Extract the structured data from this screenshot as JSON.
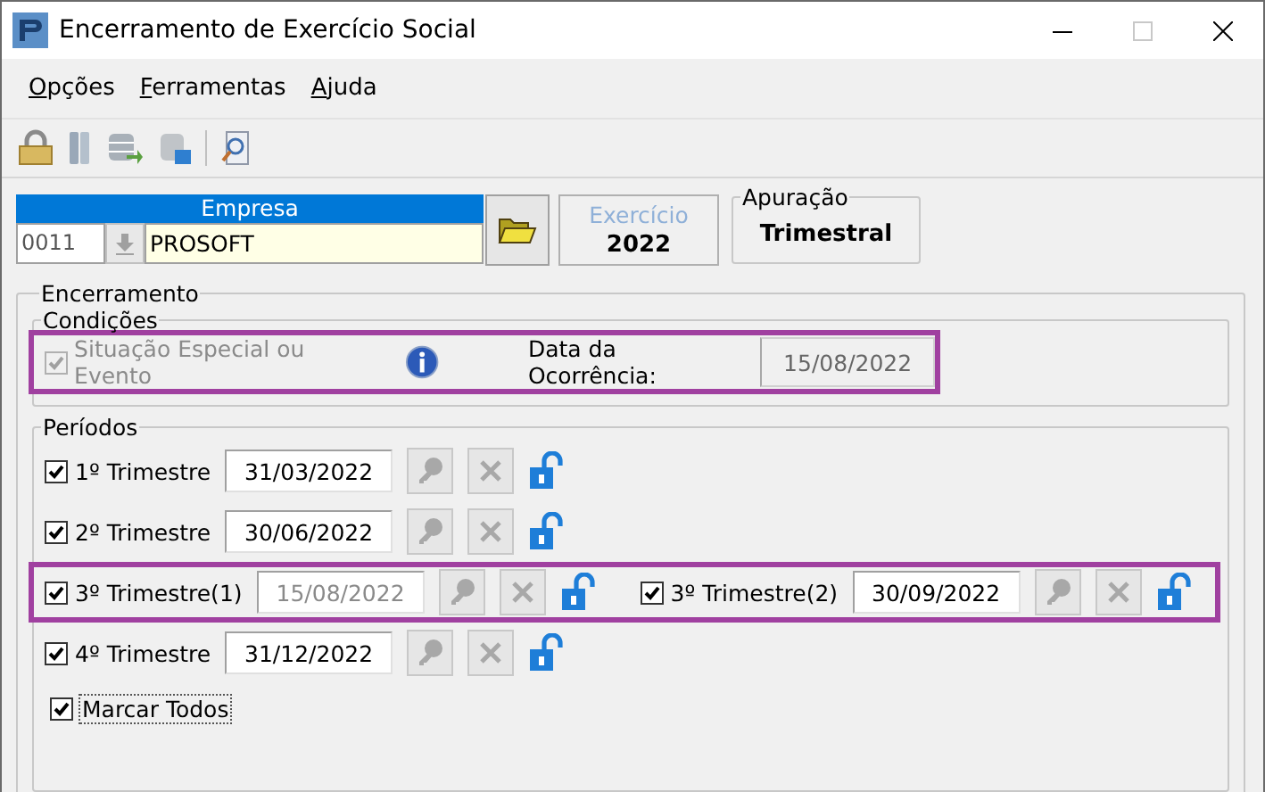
{
  "window": {
    "title": "Encerramento de Exercício Social"
  },
  "menu": [
    {
      "label": "Opções"
    },
    {
      "label": "Ferramentas"
    },
    {
      "label": "Ajuda"
    }
  ],
  "empresa": {
    "label": "Empresa",
    "code": "0011",
    "name": "PROSOFT"
  },
  "exercicio": {
    "label": "Exercício",
    "value": "2022"
  },
  "apuracao": {
    "label": "Apuração",
    "value": "Trimestral"
  },
  "encerramento": {
    "title": "Encerramento",
    "condicoes": {
      "title": "Condições",
      "highlighted": true,
      "special_label": "Situação Especial ou Evento",
      "special_checked": true,
      "special_disabled": true,
      "date_label": "Data da Ocorrência:",
      "date_value": "15/08/2022"
    },
    "periodos": {
      "title": "Períodos",
      "rows": [
        {
          "highlighted": false,
          "items": [
            {
              "label": "1º Trimestre",
              "checked": true,
              "date": "31/03/2022",
              "date_disabled": false
            }
          ]
        },
        {
          "highlighted": false,
          "items": [
            {
              "label": "2º Trimestre",
              "checked": true,
              "date": "30/06/2022",
              "date_disabled": false
            }
          ]
        },
        {
          "highlighted": true,
          "items": [
            {
              "label": "3º Trimestre(1)",
              "checked": true,
              "date": "15/08/2022",
              "date_disabled": true
            },
            {
              "label": "3º Trimestre(2)",
              "checked": true,
              "date": "30/09/2022",
              "date_disabled": false
            }
          ]
        },
        {
          "highlighted": false,
          "items": [
            {
              "label": "4º Trimestre",
              "checked": true,
              "date": "31/12/2022",
              "date_disabled": false
            }
          ]
        }
      ],
      "mark_all": {
        "label": "Marcar Todos",
        "checked": true
      }
    }
  }
}
